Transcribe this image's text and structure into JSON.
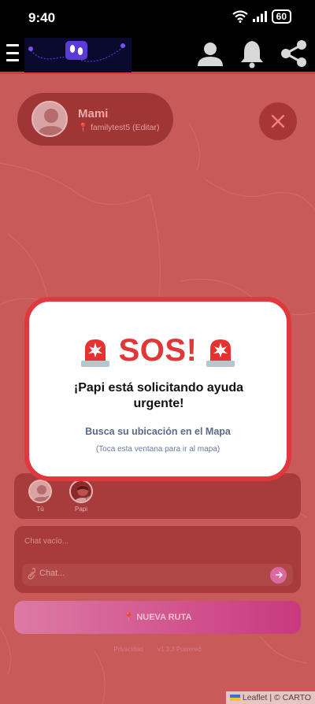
{
  "status_bar": {
    "time": "9:40",
    "battery": "60"
  },
  "header": {
    "menu_icon": "hamburger-icon",
    "logo_icon": "footprints-icon",
    "profile_icon": "user-icon",
    "notifications_icon": "bell-icon",
    "share_icon": "share-icon"
  },
  "profile": {
    "name": "Mami",
    "subtitle": "📍 familytest5 (Editar)"
  },
  "close_button": {
    "icon": "close-icon"
  },
  "sos_modal": {
    "title": "SOS!",
    "icon": "siren-icon",
    "message": "¡Papi está solicitando ayuda urgente!",
    "link_text": "Busca su ubicación en el Mapa",
    "hint": "(Toca esta ventana para ir al mapa)"
  },
  "members": [
    {
      "label": "Tú"
    },
    {
      "label": "Papi"
    }
  ],
  "chat": {
    "empty_text": "Chat vacío...",
    "input_placeholder": "Chat...",
    "send_icon": "arrow-right-icon",
    "attach_icon": "paperclip-icon"
  },
  "route_button": {
    "label": "📍 NUEVA RUTA"
  },
  "footer": {
    "privacy": "Privacidad",
    "version": "v1.3.3 Powered"
  },
  "map_attribution": {
    "leaflet": "Leaflet",
    "separator": " | © ",
    "carto": "CARTO"
  },
  "colors": {
    "overlay": "#c85a5a",
    "sos_red": "#e03838",
    "route_gradient_end": "#c9397f"
  }
}
